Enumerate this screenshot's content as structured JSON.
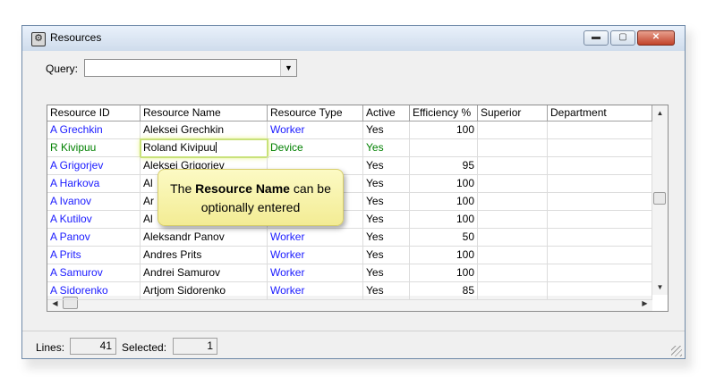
{
  "window": {
    "title": "Resources",
    "icon": "resources-gear-icon",
    "controls": {
      "minimize": "▬",
      "maximize": "▢",
      "close": "✕"
    }
  },
  "query": {
    "label": "Query:",
    "value": ""
  },
  "columns": [
    "Resource ID",
    "Resource Name",
    "Resource Type",
    "Active",
    "Efficiency %",
    "Superior",
    "Department"
  ],
  "rows": [
    {
      "id": "A Grechkin",
      "name": "Aleksei Grechkin",
      "type": "Worker",
      "active": "Yes",
      "efficiency": "100"
    },
    {
      "id": "R Kivipuu",
      "name": "Roland Kivipuu",
      "type": "Device",
      "active": "Yes",
      "efficiency": ""
    },
    {
      "id": "A Grigorjev",
      "name": "Aleksei Grigoriev",
      "type": "",
      "active": "Yes",
      "efficiency": "95"
    },
    {
      "id": "A Harkova",
      "name": "Al",
      "type": "",
      "active": "Yes",
      "efficiency": "100"
    },
    {
      "id": "A Ivanov",
      "name": "Ar",
      "type": "",
      "active": "Yes",
      "efficiency": "100"
    },
    {
      "id": "A Kutilov",
      "name": "Al",
      "type": "",
      "active": "Yes",
      "efficiency": "100"
    },
    {
      "id": "A Panov",
      "name": "Aleksandr Panov",
      "type": "Worker",
      "active": "Yes",
      "efficiency": "50"
    },
    {
      "id": "A Prits",
      "name": "Andres Prits",
      "type": "Worker",
      "active": "Yes",
      "efficiency": "100"
    },
    {
      "id": "A Samurov",
      "name": "Andrei Samurov",
      "type": "Worker",
      "active": "Yes",
      "efficiency": "100"
    },
    {
      "id": "A Sidorenko",
      "name": "Artjom Sidorenko",
      "type": "Worker",
      "active": "Yes",
      "efficiency": "85"
    }
  ],
  "status": {
    "lines_label": "Lines:",
    "lines_value": "41",
    "selected_label": "Selected:",
    "selected_value": "1"
  },
  "callout": {
    "prefix": "The",
    "bold": "Resource Name",
    "suffix": "can be optionally entered"
  },
  "colors": {
    "link_blue": "#1a1aff",
    "device_green": "#008000",
    "callout_bg": "#f7f1a8"
  }
}
